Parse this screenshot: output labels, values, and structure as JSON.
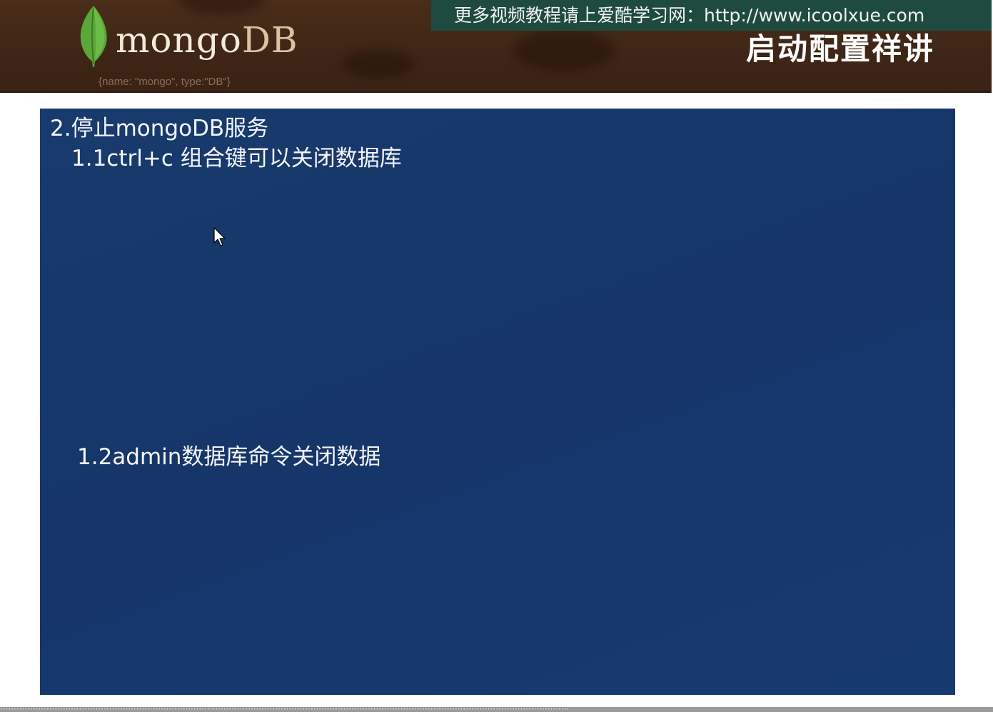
{
  "header": {
    "logo_primary": "mongo",
    "logo_secondary": "DB",
    "logo_tagline": "{name: \"mongo\", type:\"DB\"}",
    "banner_text": "更多视频教程请上爱酷学习网：http://www.icoolxue.com",
    "slide_title": "启动配置祥讲"
  },
  "slide": {
    "heading": "2.停止mongoDB服务",
    "item_1": "1.1ctrl+c 组合键可以关闭数据库",
    "item_2": "1.2admin数据库命令关闭数据"
  },
  "icons": {
    "logo": "mongodb-leaf-icon",
    "pointer": "mouse-cursor-icon"
  },
  "colors": {
    "header_bg": "#3f2616",
    "banner_bg": "#1f4a3f",
    "slide_bg": "#16366a",
    "leaf_green": "#5aa83a"
  }
}
